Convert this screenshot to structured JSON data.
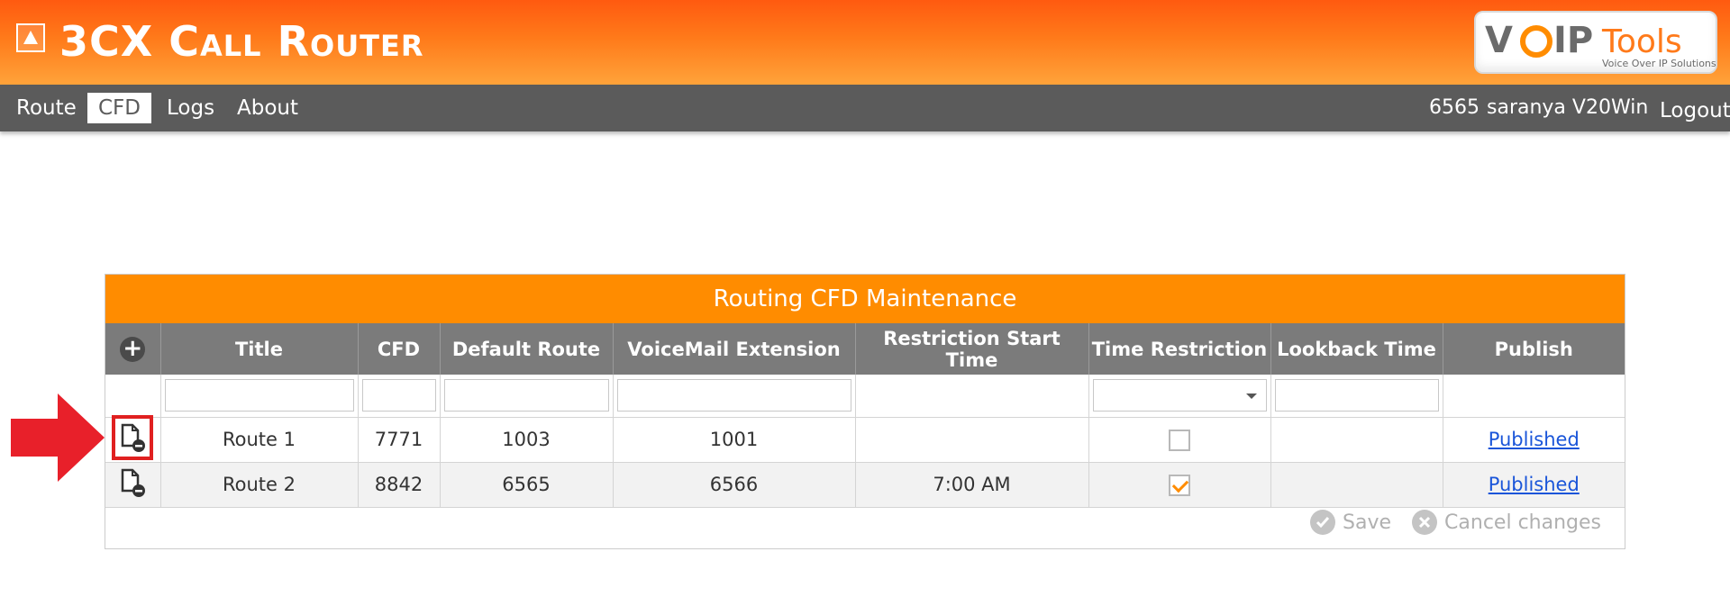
{
  "app": {
    "title": "3CX Call Router",
    "logo_text": "VOIPTools",
    "logo_tagline": "Voice Over IP Solutions"
  },
  "nav": {
    "items": [
      {
        "label": "Route",
        "active": false
      },
      {
        "label": "CFD",
        "active": true
      },
      {
        "label": "Logs",
        "active": false
      },
      {
        "label": "About",
        "active": false
      }
    ],
    "user_ext": "6565",
    "user_name": "saranya V20Win",
    "logout_label": "Logout"
  },
  "panel": {
    "title": "Routing CFD Maintenance",
    "columns": [
      "Title",
      "CFD",
      "Default Route",
      "VoiceMail Extension",
      "Restriction Start Time",
      "Time Restriction",
      "Lookback Time",
      "Publish"
    ],
    "rows": [
      {
        "title": "Route 1",
        "cfd": "7771",
        "default_route": "1003",
        "voicemail_ext": "1001",
        "restriction_start": "",
        "time_restriction": false,
        "lookback": "",
        "publish": "Published"
      },
      {
        "title": "Route 2",
        "cfd": "8842",
        "default_route": "6565",
        "voicemail_ext": "6566",
        "restriction_start": "7:00 AM",
        "time_restriction": true,
        "lookback": "",
        "publish": "Published"
      }
    ],
    "save_label": "Save",
    "cancel_label": "Cancel changes"
  },
  "colors": {
    "header_orange": "#ff6a10",
    "panel_orange": "#ff8c00",
    "nav_gray": "#5b5b5b",
    "link_blue": "#1a55d9",
    "highlight_red": "#e02020"
  }
}
